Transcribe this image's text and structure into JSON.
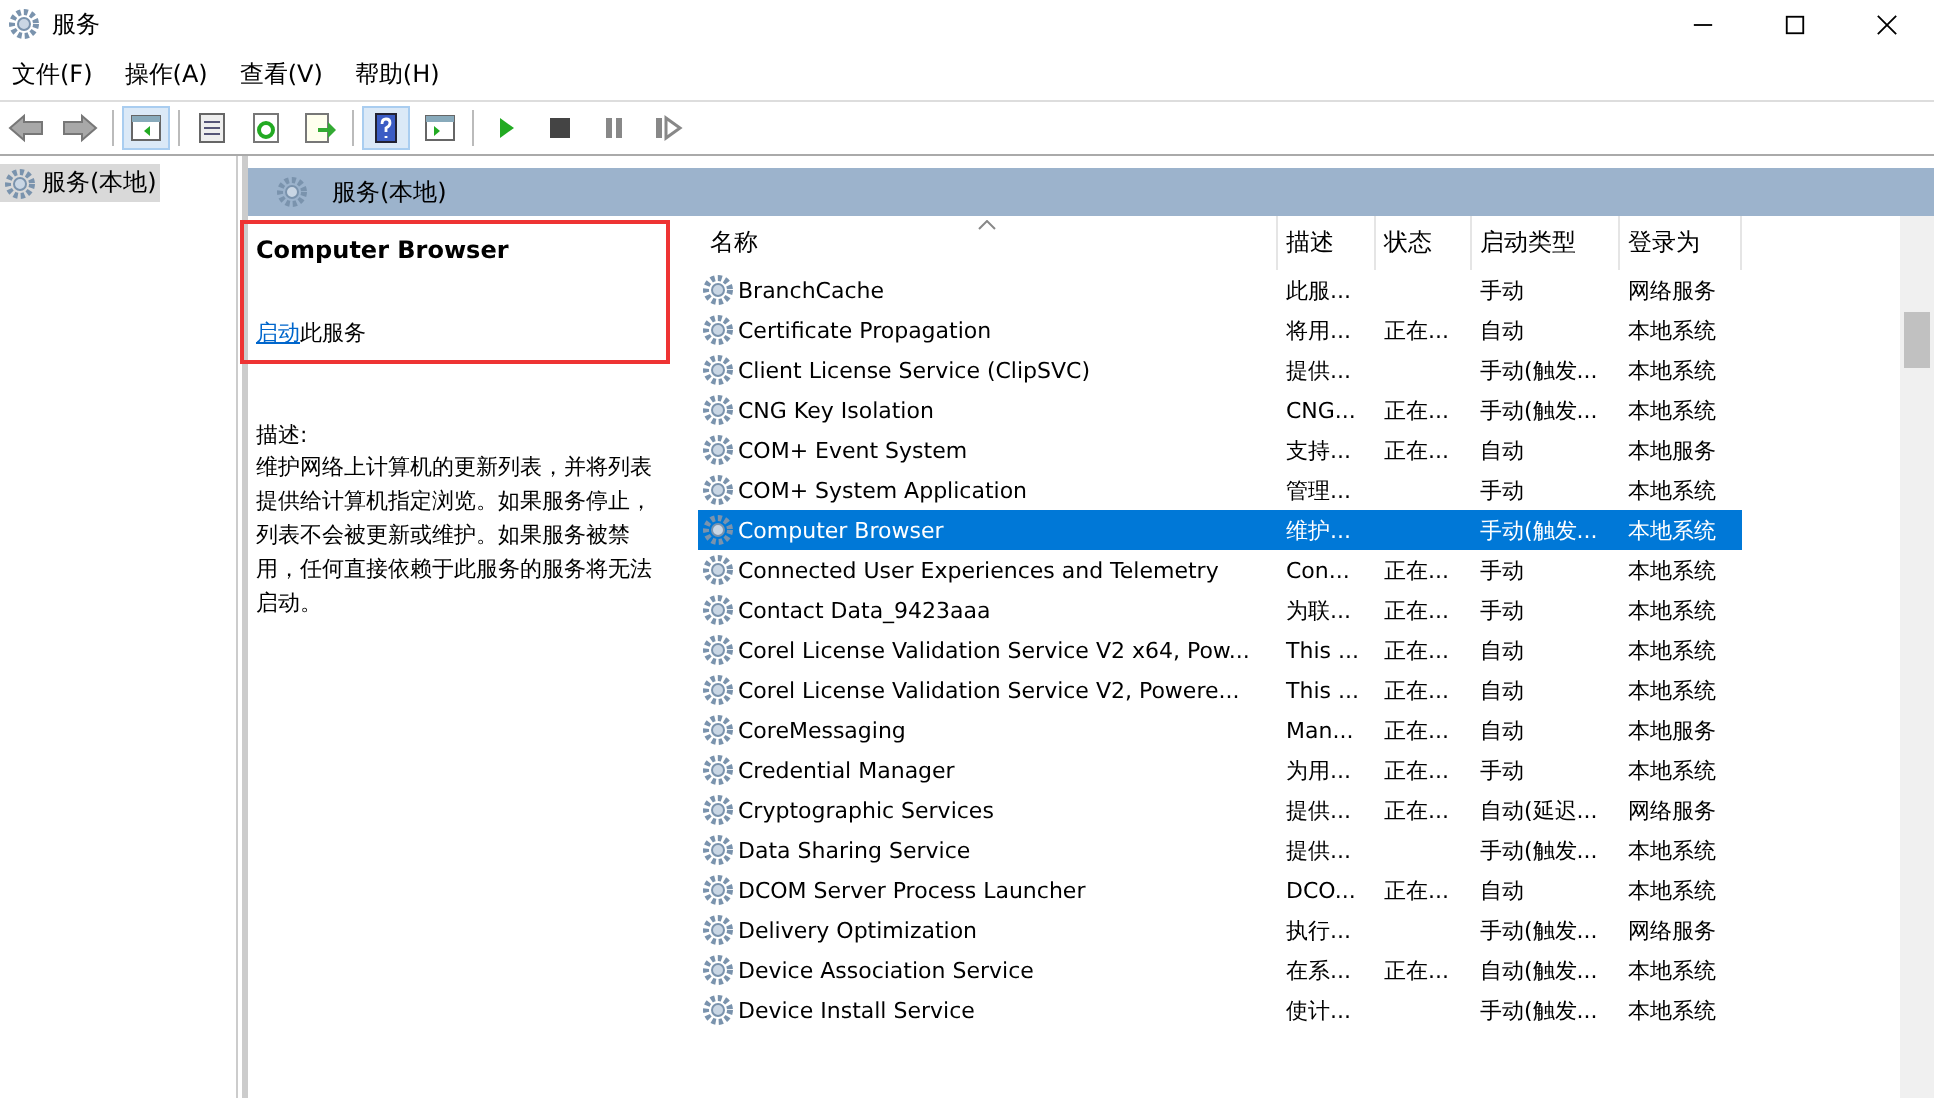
{
  "window": {
    "title": "服务"
  },
  "menu": [
    "文件(F)",
    "操作(A)",
    "查看(V)",
    "帮助(H)"
  ],
  "tree": {
    "items": [
      {
        "label": "服务(本地)",
        "selected": true
      }
    ]
  },
  "panel_header": "服务(本地)",
  "details": {
    "service_name": "Computer Browser",
    "action_link": "启动",
    "action_rest": "此服务",
    "description_label": "描述:",
    "description": "维护网络上计算机的更新列表，并将列表提供给计算机指定浏览。如果服务停止，列表不会被更新或维护。如果服务被禁用，任何直接依赖于此服务的服务将无法启动。"
  },
  "table": {
    "columns": [
      "名称",
      "描述",
      "状态",
      "启动类型",
      "登录为"
    ],
    "rows": [
      {
        "name": "BranchCache",
        "desc": "此服...",
        "status": "",
        "startup": "手动",
        "logon": "网络服务",
        "selected": false
      },
      {
        "name": "Certificate Propagation",
        "desc": "将用...",
        "status": "正在...",
        "startup": "自动",
        "logon": "本地系统",
        "selected": false
      },
      {
        "name": "Client License Service (ClipSVC)",
        "desc": "提供...",
        "status": "",
        "startup": "手动(触发...",
        "logon": "本地系统",
        "selected": false
      },
      {
        "name": "CNG Key Isolation",
        "desc": "CNG...",
        "status": "正在...",
        "startup": "手动(触发...",
        "logon": "本地系统",
        "selected": false
      },
      {
        "name": "COM+ Event System",
        "desc": "支持...",
        "status": "正在...",
        "startup": "自动",
        "logon": "本地服务",
        "selected": false
      },
      {
        "name": "COM+ System Application",
        "desc": "管理...",
        "status": "",
        "startup": "手动",
        "logon": "本地系统",
        "selected": false
      },
      {
        "name": "Computer Browser",
        "desc": "维护...",
        "status": "",
        "startup": "手动(触发...",
        "logon": "本地系统",
        "selected": true
      },
      {
        "name": "Connected User Experiences and Telemetry",
        "desc": "Con...",
        "status": "正在...",
        "startup": "手动",
        "logon": "本地系统",
        "selected": false
      },
      {
        "name": "Contact Data_9423aaa",
        "desc": "为联...",
        "status": "正在...",
        "startup": "手动",
        "logon": "本地系统",
        "selected": false
      },
      {
        "name": "Corel License Validation Service V2 x64, Pow...",
        "desc": "This ...",
        "status": "正在...",
        "startup": "自动",
        "logon": "本地系统",
        "selected": false
      },
      {
        "name": "Corel License Validation Service V2, Powere...",
        "desc": "This ...",
        "status": "正在...",
        "startup": "自动",
        "logon": "本地系统",
        "selected": false
      },
      {
        "name": "CoreMessaging",
        "desc": "Man...",
        "status": "正在...",
        "startup": "自动",
        "logon": "本地服务",
        "selected": false
      },
      {
        "name": "Credential Manager",
        "desc": "为用...",
        "status": "正在...",
        "startup": "手动",
        "logon": "本地系统",
        "selected": false
      },
      {
        "name": "Cryptographic Services",
        "desc": "提供...",
        "status": "正在...",
        "startup": "自动(延迟...",
        "logon": "网络服务",
        "selected": false
      },
      {
        "name": "Data Sharing Service",
        "desc": "提供...",
        "status": "",
        "startup": "手动(触发...",
        "logon": "本地系统",
        "selected": false
      },
      {
        "name": "DCOM Server Process Launcher",
        "desc": "DCO...",
        "status": "正在...",
        "startup": "自动",
        "logon": "本地系统",
        "selected": false
      },
      {
        "name": "Delivery Optimization",
        "desc": "执行...",
        "status": "",
        "startup": "手动(触发...",
        "logon": "网络服务",
        "selected": false
      },
      {
        "name": "Device Association Service",
        "desc": "在系...",
        "status": "正在...",
        "startup": "自动(触发...",
        "logon": "本地系统",
        "selected": false
      },
      {
        "name": "Device Install Service",
        "desc": "使计...",
        "status": "",
        "startup": "手动(触发...",
        "logon": "本地系统",
        "selected": false
      }
    ]
  }
}
